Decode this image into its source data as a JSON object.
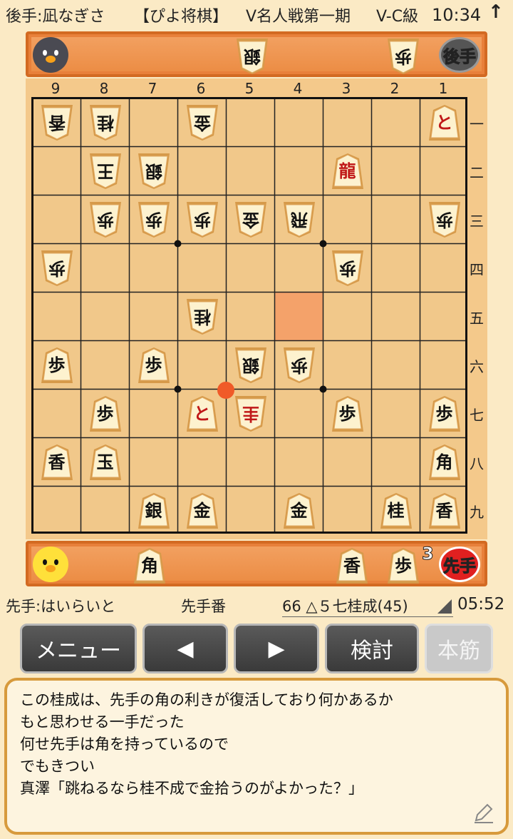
{
  "status_bar": {
    "gote_player": "後手:凪なぎさ",
    "app_name": "【ぴよ将棋】",
    "event": "V名人戦第一期",
    "class": "V-C級",
    "time": "10:34",
    "arrow_icon": "up-arrow-icon"
  },
  "gote_hand": {
    "badge": "後手",
    "pieces": [
      {
        "char": "銀",
        "count": ""
      },
      {
        "char": "歩",
        "count": ""
      }
    ]
  },
  "sente_hand": {
    "badge": "先手",
    "pieces": [
      {
        "char": "角",
        "count": ""
      },
      {
        "char": "香",
        "count": ""
      },
      {
        "char": "歩",
        "count": "3"
      }
    ]
  },
  "board": {
    "files": [
      "9",
      "8",
      "7",
      "6",
      "5",
      "4",
      "3",
      "2",
      "1"
    ],
    "ranks": [
      "一",
      "二",
      "三",
      "四",
      "五",
      "六",
      "七",
      "八",
      "九"
    ],
    "last_move_square": {
      "file": 4,
      "rank": 5
    },
    "move_dot_square": {
      "file": 5,
      "rank": 7
    },
    "pieces": [
      {
        "file": 9,
        "rank": 1,
        "char": "香",
        "side": "gote",
        "promoted": false
      },
      {
        "file": 8,
        "rank": 1,
        "char": "桂",
        "side": "gote",
        "promoted": false
      },
      {
        "file": 6,
        "rank": 1,
        "char": "金",
        "side": "gote",
        "promoted": false
      },
      {
        "file": 1,
        "rank": 1,
        "char": "と",
        "side": "sente",
        "promoted": true
      },
      {
        "file": 8,
        "rank": 2,
        "char": "王",
        "side": "gote",
        "promoted": false
      },
      {
        "file": 7,
        "rank": 2,
        "char": "銀",
        "side": "gote",
        "promoted": false
      },
      {
        "file": 3,
        "rank": 2,
        "char": "龍",
        "side": "sente",
        "promoted": true
      },
      {
        "file": 8,
        "rank": 3,
        "char": "歩",
        "side": "gote",
        "promoted": false
      },
      {
        "file": 7,
        "rank": 3,
        "char": "歩",
        "side": "gote",
        "promoted": false
      },
      {
        "file": 6,
        "rank": 3,
        "char": "歩",
        "side": "gote",
        "promoted": false
      },
      {
        "file": 5,
        "rank": 3,
        "char": "金",
        "side": "gote",
        "promoted": false
      },
      {
        "file": 4,
        "rank": 3,
        "char": "飛",
        "side": "gote",
        "promoted": false
      },
      {
        "file": 1,
        "rank": 3,
        "char": "歩",
        "side": "gote",
        "promoted": false
      },
      {
        "file": 9,
        "rank": 4,
        "char": "歩",
        "side": "gote",
        "promoted": false
      },
      {
        "file": 3,
        "rank": 4,
        "char": "歩",
        "side": "gote",
        "promoted": false
      },
      {
        "file": 6,
        "rank": 5,
        "char": "桂",
        "side": "gote",
        "promoted": false
      },
      {
        "file": 9,
        "rank": 6,
        "char": "歩",
        "side": "sente",
        "promoted": false
      },
      {
        "file": 7,
        "rank": 6,
        "char": "歩",
        "side": "sente",
        "promoted": false
      },
      {
        "file": 5,
        "rank": 6,
        "char": "銀",
        "side": "gote",
        "promoted": false
      },
      {
        "file": 4,
        "rank": 6,
        "char": "歩",
        "side": "gote",
        "promoted": false
      },
      {
        "file": 8,
        "rank": 7,
        "char": "歩",
        "side": "sente",
        "promoted": false
      },
      {
        "file": 6,
        "rank": 7,
        "char": "と",
        "side": "sente",
        "promoted": true
      },
      {
        "file": 5,
        "rank": 7,
        "char": "圭",
        "side": "gote",
        "promoted": true
      },
      {
        "file": 3,
        "rank": 7,
        "char": "歩",
        "side": "sente",
        "promoted": false
      },
      {
        "file": 1,
        "rank": 7,
        "char": "歩",
        "side": "sente",
        "promoted": false
      },
      {
        "file": 9,
        "rank": 8,
        "char": "香",
        "side": "sente",
        "promoted": false
      },
      {
        "file": 8,
        "rank": 8,
        "char": "玉",
        "side": "sente",
        "promoted": false
      },
      {
        "file": 1,
        "rank": 8,
        "char": "角",
        "side": "sente",
        "promoted": false
      },
      {
        "file": 7,
        "rank": 9,
        "char": "銀",
        "side": "sente",
        "promoted": false
      },
      {
        "file": 6,
        "rank": 9,
        "char": "金",
        "side": "sente",
        "promoted": false
      },
      {
        "file": 4,
        "rank": 9,
        "char": "金",
        "side": "sente",
        "promoted": false
      },
      {
        "file": 2,
        "rank": 9,
        "char": "桂",
        "side": "sente",
        "promoted": false
      },
      {
        "file": 1,
        "rank": 9,
        "char": "香",
        "side": "sente",
        "promoted": false
      }
    ]
  },
  "info": {
    "sente_player": "先手:はいらいと",
    "turn": "先手番",
    "move": "66 △５七桂成(45)",
    "clock": "05:52"
  },
  "controls": {
    "menu_label": "メニュー",
    "prev_label": "◀",
    "next_label": "▶",
    "analyze_label": "検討",
    "mainline_label": "本筋"
  },
  "comment": {
    "lines": [
      "この桂成は、先手の角の利きが復活しており何かあるか",
      "もと思わせる一手だった",
      "何せ先手は角を持っているので",
      "でもきつい",
      "真澤「跳ねるなら桂不成で金拾うのがよかった？」"
    ],
    "edit_icon": "pencil-icon"
  },
  "colors": {
    "board": "#f1c88a",
    "hand_panel": "#ec8d45",
    "highlight": "#f4a26a",
    "dot": "#f05a28",
    "promoted_text": "#c01818"
  }
}
